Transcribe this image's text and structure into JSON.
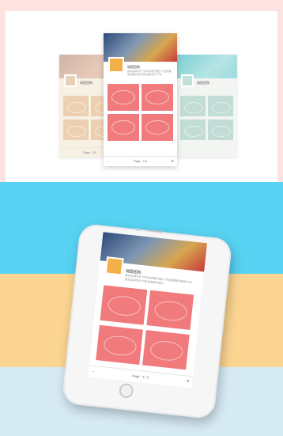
{
  "mockup": {
    "title": "瑞国团购",
    "description": "赛车品牌系列 汽车高清细节图片 点击查看更多精彩内容 赛车品牌系列 汽车",
    "pager": "Page：1/2",
    "back_icon": "arrow-left-icon",
    "more_icon": "gear-icon"
  },
  "phone_screen": {
    "title": "瑞国团购",
    "description": "赛车品牌系列 汽车高清细节图片 点击查看更多精彩内容 赛车品牌系列 汽车高清细节图片",
    "pager": "Page：1 / 2",
    "back_icon": "arrow-left-icon",
    "more_icon": "gear-icon"
  },
  "colors": {
    "background": "#fce3e1",
    "band_blue": "#58d2f2",
    "band_yellow": "#fcd592",
    "band_pale": "#d7ebf5",
    "accent_red": "#f07a7c",
    "accent_orange": "#f4b048"
  }
}
